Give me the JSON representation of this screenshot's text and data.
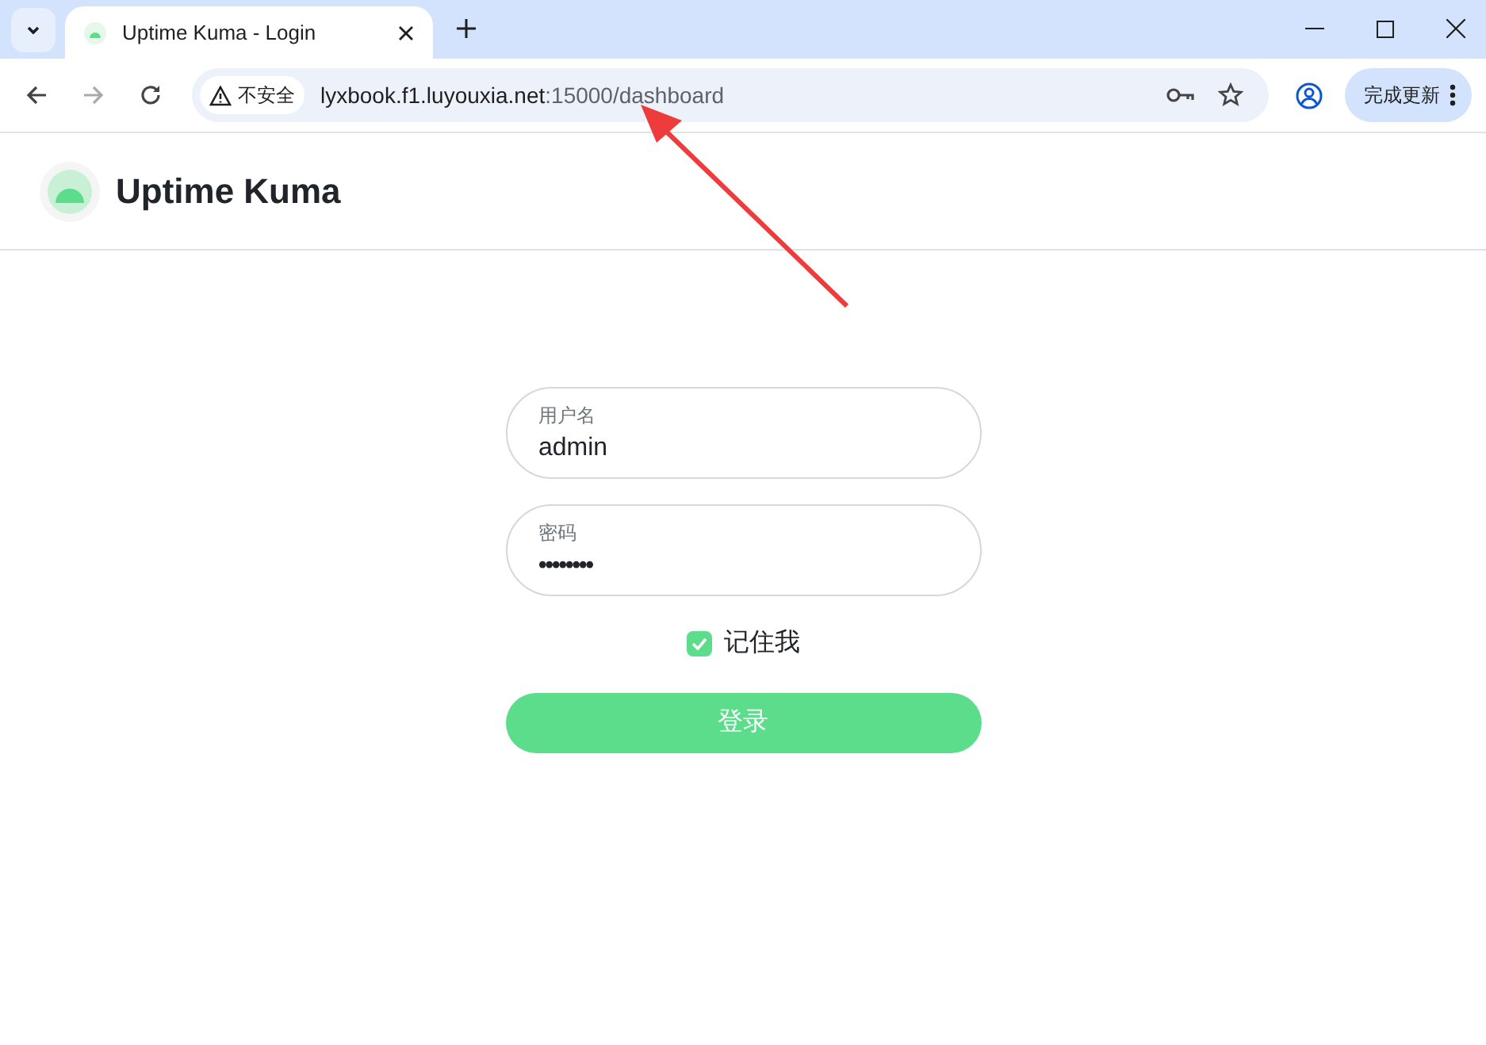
{
  "browser": {
    "tab": {
      "title": "Uptime Kuma - Login",
      "selected": true
    },
    "security_label": "不安全",
    "url_host": "lyxbook.f1.luyouxia.net",
    "url_rest": ":15000/dashboard",
    "update_button": "完成更新"
  },
  "header": {
    "brand": "Uptime Kuma"
  },
  "form": {
    "username": {
      "label": "用户名",
      "value": "admin"
    },
    "password": {
      "label": "密码",
      "value": "••••••••"
    },
    "remember": {
      "label": "记住我",
      "checked": true
    },
    "submit": "登录"
  }
}
